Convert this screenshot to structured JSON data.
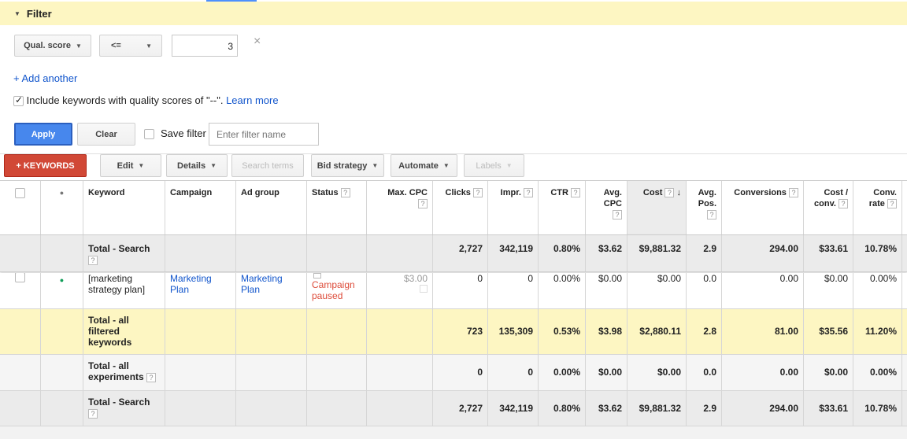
{
  "filter": {
    "title": "Filter",
    "field_label": "Qual. score",
    "operator_label": "<=",
    "value": "3",
    "add_another": "+ Add another",
    "include_text": "Include keywords with quality scores of \"--\".",
    "learn_more": "Learn more",
    "apply_label": "Apply",
    "clear_label": "Clear",
    "save_filter_label": "Save filter",
    "filter_name_placeholder": "Enter filter name"
  },
  "toolbar": {
    "keywords_label": "+ KEYWORDS",
    "edit_label": "Edit",
    "details_label": "Details",
    "search_terms_label": "Search terms",
    "bid_strategy_label": "Bid strategy",
    "automate_label": "Automate",
    "labels_label": "Labels"
  },
  "columns": {
    "keyword": "Keyword",
    "campaign": "Campaign",
    "ad_group": "Ad group",
    "status": "Status",
    "max_cpc": "Max. CPC",
    "clicks": "Clicks",
    "impr": "Impr.",
    "ctr": "CTR",
    "avg_cpc": "Avg. CPC",
    "cost": "Cost",
    "avg_pos": "Avg. Pos.",
    "conversions": "Conversions",
    "cost_conv": "Cost / conv.",
    "conv_rate": "Conv. rate"
  },
  "rows": {
    "total_search_top": {
      "label": "Total - Search",
      "clicks": "2,727",
      "impr": "342,119",
      "ctr": "0.80%",
      "avg_cpc": "$3.62",
      "cost": "$9,881.32",
      "avg_pos": "2.9",
      "conversions": "294.00",
      "cost_conv": "$33.61",
      "conv_rate": "10.78%"
    },
    "keyword_row": {
      "keyword": "[marketing strategy plan]",
      "campaign": "Marketing Plan",
      "ad_group": "Marketing Plan",
      "status": "Campaign paused",
      "max_cpc": "$3.00",
      "clicks": "0",
      "impr": "0",
      "ctr": "0.00%",
      "avg_cpc": "$0.00",
      "cost": "$0.00",
      "avg_pos": "0.0",
      "conversions": "0.00",
      "cost_conv": "$0.00",
      "conv_rate": "0.00%"
    },
    "total_filtered": {
      "label": "Total - all filtered keywords",
      "clicks": "723",
      "impr": "135,309",
      "ctr": "0.53%",
      "avg_cpc": "$3.98",
      "cost": "$2,880.11",
      "avg_pos": "2.8",
      "conversions": "81.00",
      "cost_conv": "$35.56",
      "conv_rate": "11.20%"
    },
    "total_experiments": {
      "label": "Total - all experiments",
      "clicks": "0",
      "impr": "0",
      "ctr": "0.00%",
      "avg_cpc": "$0.00",
      "cost": "$0.00",
      "avg_pos": "0.0",
      "conversions": "0.00",
      "cost_conv": "$0.00",
      "conv_rate": "0.00%"
    },
    "total_search_bottom": {
      "label": "Total - Search",
      "clicks": "2,727",
      "impr": "342,119",
      "ctr": "0.80%",
      "avg_cpc": "$3.62",
      "cost": "$9,881.32",
      "avg_pos": "2.9",
      "conversions": "294.00",
      "cost_conv": "$33.61",
      "conv_rate": "10.78%"
    }
  },
  "icons": {
    "help": "?",
    "close": "×",
    "sort": "↓",
    "status_dot": "●"
  },
  "colors": {
    "filter_bg": "#fdf6c2",
    "apply_blue": "#4787ed",
    "keywords_red": "#d14836",
    "link_blue": "#1155cc",
    "paused_orange": "#dd4b39",
    "enabled_green": "#0f9d58",
    "filtered_total_bg": "#fdf6c2",
    "total_gray_bg": "#ebebeb"
  }
}
